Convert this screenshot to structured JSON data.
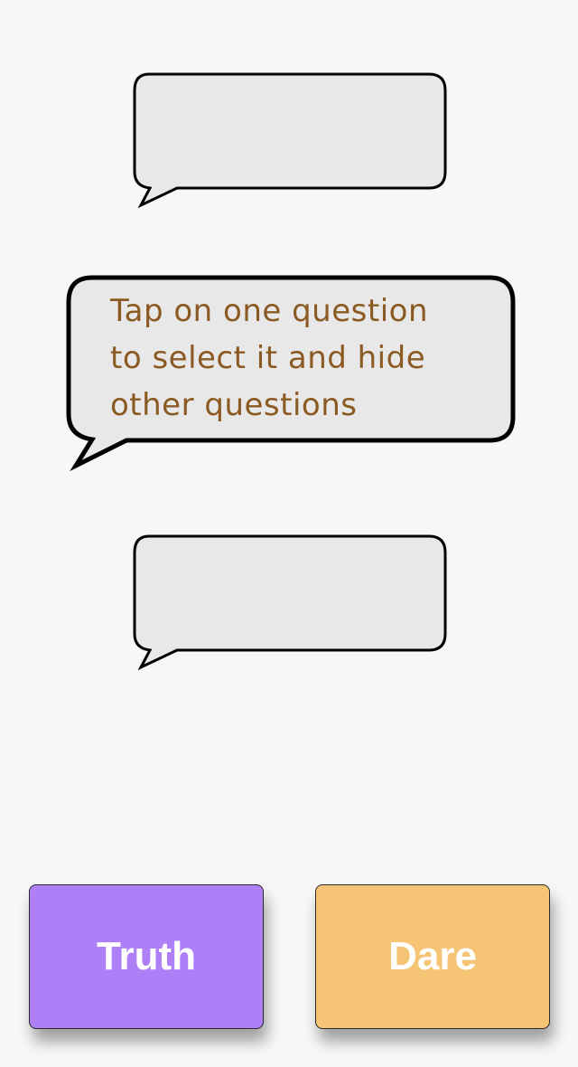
{
  "hint": {
    "text": "Tap on one question\nto select it and hide\nother questions"
  },
  "buttons": {
    "truth_label": "Truth",
    "dare_label": "Dare"
  },
  "colors": {
    "background": "#f7f7f7",
    "bubble_fill": "#e8e8e8",
    "bubble_stroke": "#000000",
    "hint_text": "#8b5a22",
    "truth": "#ae7ff7",
    "dare": "#f5c475"
  }
}
